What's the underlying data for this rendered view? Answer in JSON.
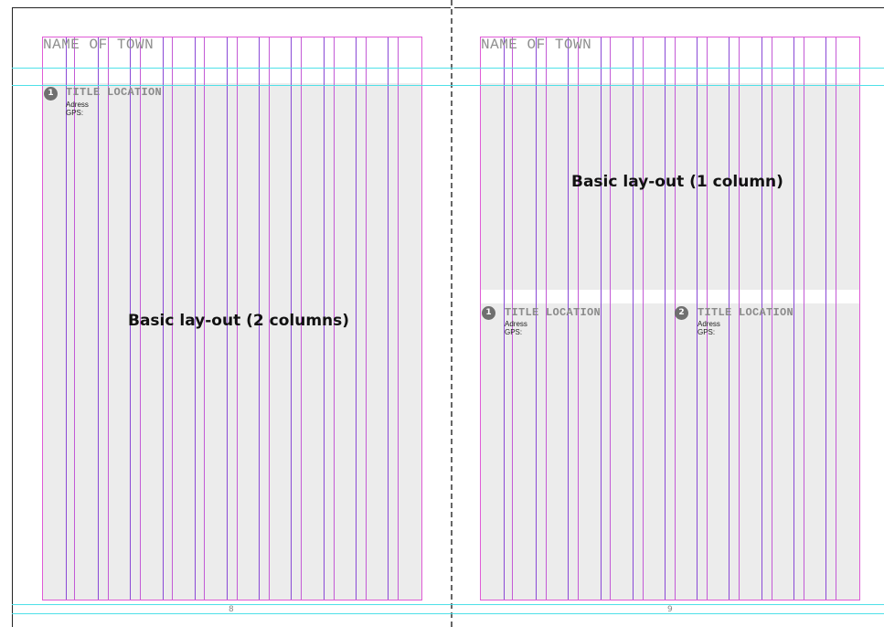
{
  "left_page": {
    "town_title": "NAME OF TOWN",
    "layout_caption": "Basic lay-out (2 columns)",
    "page_number": "8",
    "locations": [
      {
        "number": "1",
        "title": "TITLE LOCATION",
        "address": "Adress",
        "gps": "GPS:"
      }
    ]
  },
  "right_page": {
    "town_title": "NAME OF TOWN",
    "layout_caption": "Basic lay-out (1 column)",
    "page_number": "9",
    "locations": [
      {
        "number": "1",
        "title": "TITLE LOCATION",
        "address": "Adress",
        "gps": "GPS:"
      },
      {
        "number": "2",
        "title": "TITLE LOCATION",
        "address": "Adress",
        "gps": "GPS:"
      }
    ]
  },
  "colors": {
    "margin_guide": "#e05ad6",
    "column_guide": "#8a49d6",
    "horizontal_guide": "#4fe0e8",
    "placeholder_fill": "#ececec",
    "badge": "#6f6f6f"
  }
}
